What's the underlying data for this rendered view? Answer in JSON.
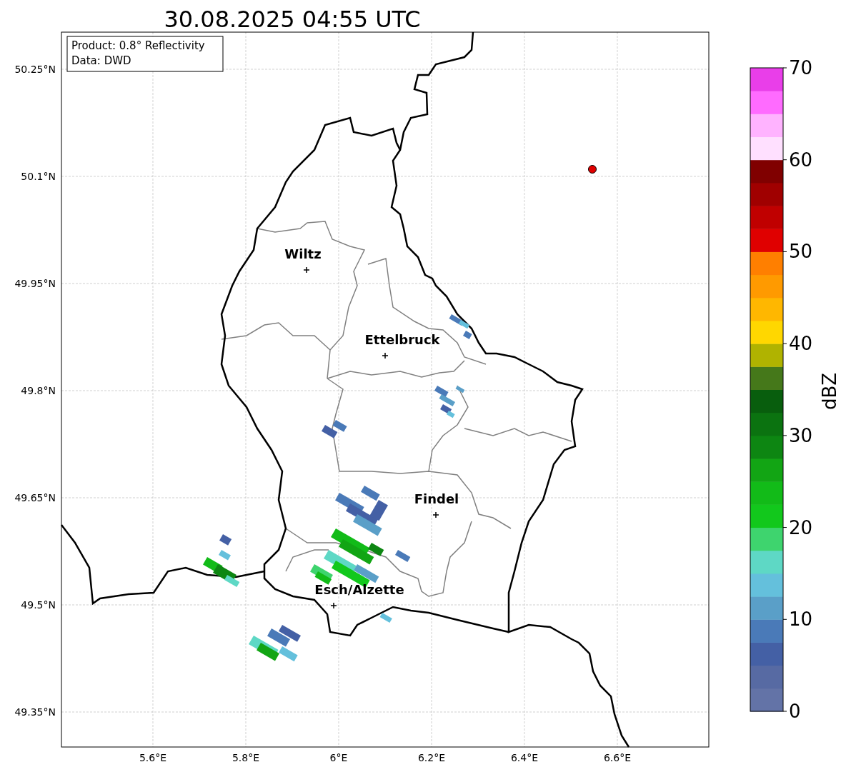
{
  "title": "30.08.2025 04:55 UTC",
  "info_box": {
    "lines": [
      "Product: 0.8° Reflectivity",
      "Data: DWD"
    ]
  },
  "map": {
    "lat_ticks": [
      "50.25°N",
      "50.1°N",
      "49.95°N",
      "49.8°N",
      "49.65°N",
      "49.5°N",
      "49.35°N"
    ],
    "lon_ticks": [
      "5.6°E",
      "5.8°E",
      "6°E",
      "6.2°E",
      "6.4°E",
      "6.6°E"
    ],
    "cities": [
      {
        "name": "Wiltz"
      },
      {
        "name": "Ettelbruck"
      },
      {
        "name": "Findel"
      },
      {
        "name": "Esch/Alzette"
      }
    ]
  },
  "colorbar": {
    "label": "dBZ",
    "ticks": [
      "70",
      "60",
      "50",
      "40",
      "30",
      "20",
      "10",
      "0"
    ]
  }
}
